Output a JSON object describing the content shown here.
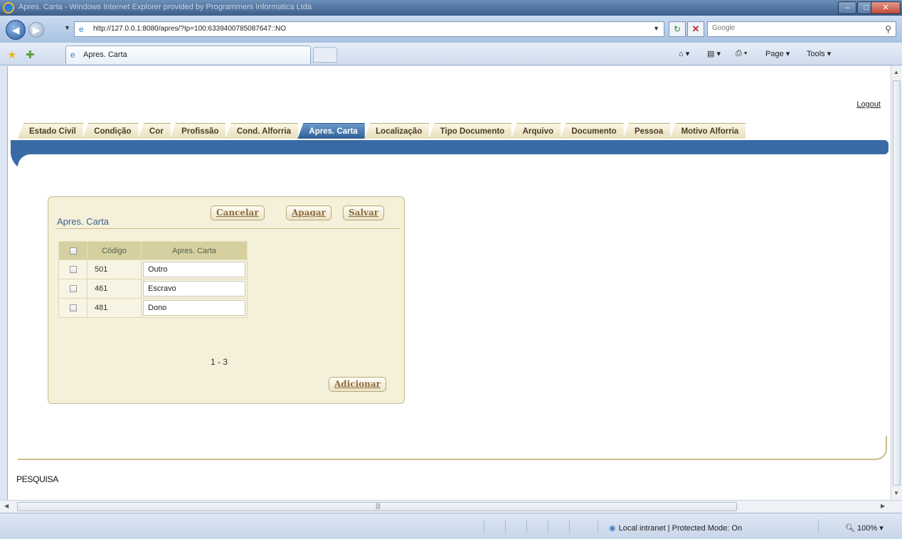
{
  "browser": {
    "window_title": "Apres. Carta - Windows Internet Explorer provided by Programmers Informatica Ltda",
    "url": "http://127.0.0.1:8080/apres/?Ip=100:6339400785087647::NO",
    "search_placeholder": "Google",
    "tab_label": "Apres. Carta",
    "page_menu": "Page ▾",
    "tools_menu": "Tools ▾",
    "status_zone": "Local intranet | Protected Mode: On",
    "zoom": "100%"
  },
  "page": {
    "logout": "Logout",
    "tabs": [
      "Estado Civil",
      "Condição",
      "Cor",
      "Profissão",
      "Cond. Alforria",
      "Apres. Carta",
      "Localização",
      "Tipo Documento",
      "Arquivo",
      "Documento",
      "Pessoa",
      "Motivo Alforria"
    ],
    "active_tab": "Apres. Carta",
    "panel": {
      "title": "Apres. Carta",
      "cancel": "Cancelar",
      "delete": "Apagar",
      "save": "Salvar",
      "add": "Adicionar",
      "columns": [
        "Código",
        "Apres. Carta"
      ],
      "rows": [
        {
          "code": "501",
          "name": "Outro"
        },
        {
          "code": "461",
          "name": "Escravo"
        },
        {
          "code": "481",
          "name": "Dono"
        }
      ],
      "pager": "1 - 3"
    },
    "search_heading": "PESQUISA"
  },
  "colors": {
    "tab_bar": "#3a6aa5",
    "active_tab": "#2f5f98",
    "panel_bg": "#f4f0d9",
    "header_bg": "#d6cf9f",
    "button_text": "#8d6b3e"
  }
}
